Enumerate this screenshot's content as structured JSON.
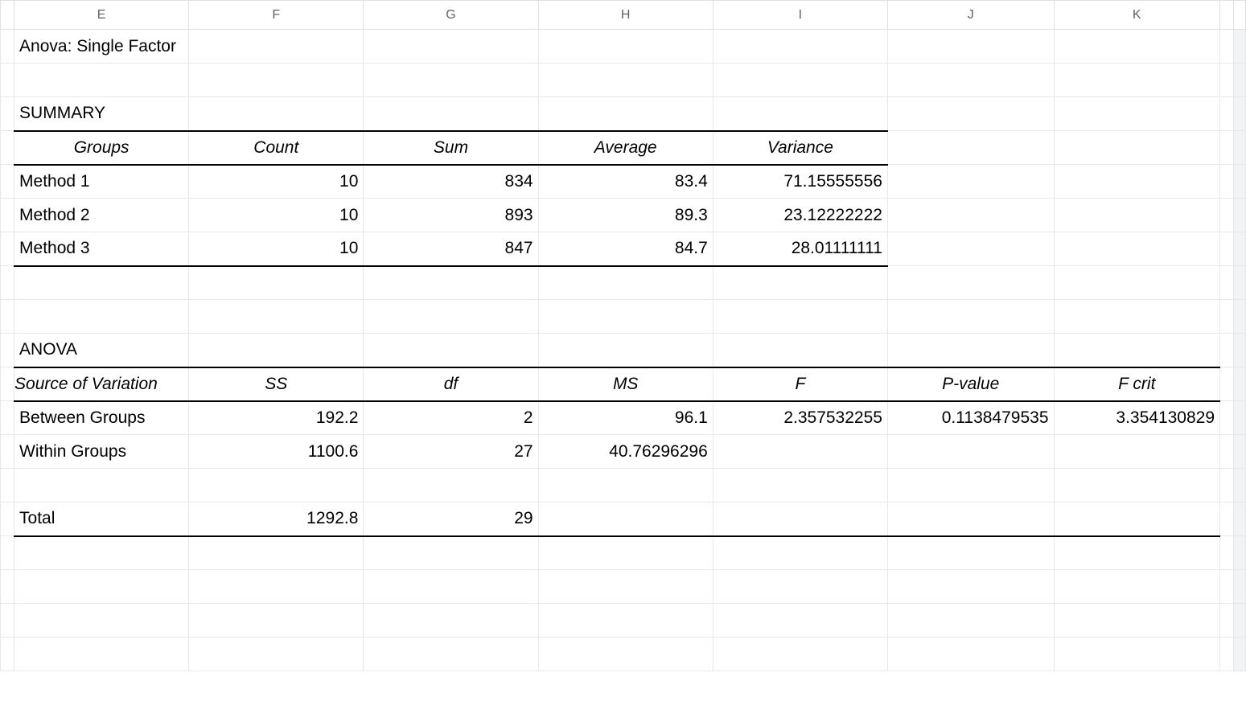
{
  "columns": {
    "E": "E",
    "F": "F",
    "G": "G",
    "H": "H",
    "I": "I",
    "J": "J",
    "K": "K"
  },
  "title": "Anova: Single Factor",
  "summary": {
    "label": "SUMMARY",
    "headers": {
      "groups": "Groups",
      "count": "Count",
      "sum": "Sum",
      "average": "Average",
      "variance": "Variance"
    },
    "rows": [
      {
        "group": "Method 1",
        "count": "10",
        "sum": "834",
        "average": "83.4",
        "variance": "71.15555556"
      },
      {
        "group": "Method 2",
        "count": "10",
        "sum": "893",
        "average": "89.3",
        "variance": "23.12222222"
      },
      {
        "group": "Method 3",
        "count": "10",
        "sum": "847",
        "average": "84.7",
        "variance": "28.01111111"
      }
    ]
  },
  "anova": {
    "label": "ANOVA",
    "headers": {
      "source": "Source of Variation",
      "ss": "SS",
      "df": "df",
      "ms": "MS",
      "f": "F",
      "pvalue": "P-value",
      "fcrit": "F crit"
    },
    "between": {
      "label": "Between Groups",
      "ss": "192.2",
      "df": "2",
      "ms": "96.1",
      "f": "2.357532255",
      "pvalue": "0.1138479535",
      "fcrit": "3.354130829"
    },
    "within": {
      "label": "Within Groups",
      "ss": "1100.6",
      "df": "27",
      "ms": "40.76296296",
      "f": "",
      "pvalue": "",
      "fcrit": ""
    },
    "total": {
      "label": "Total",
      "ss": "1292.8",
      "df": "29",
      "ms": "",
      "f": "",
      "pvalue": "",
      "fcrit": ""
    }
  }
}
